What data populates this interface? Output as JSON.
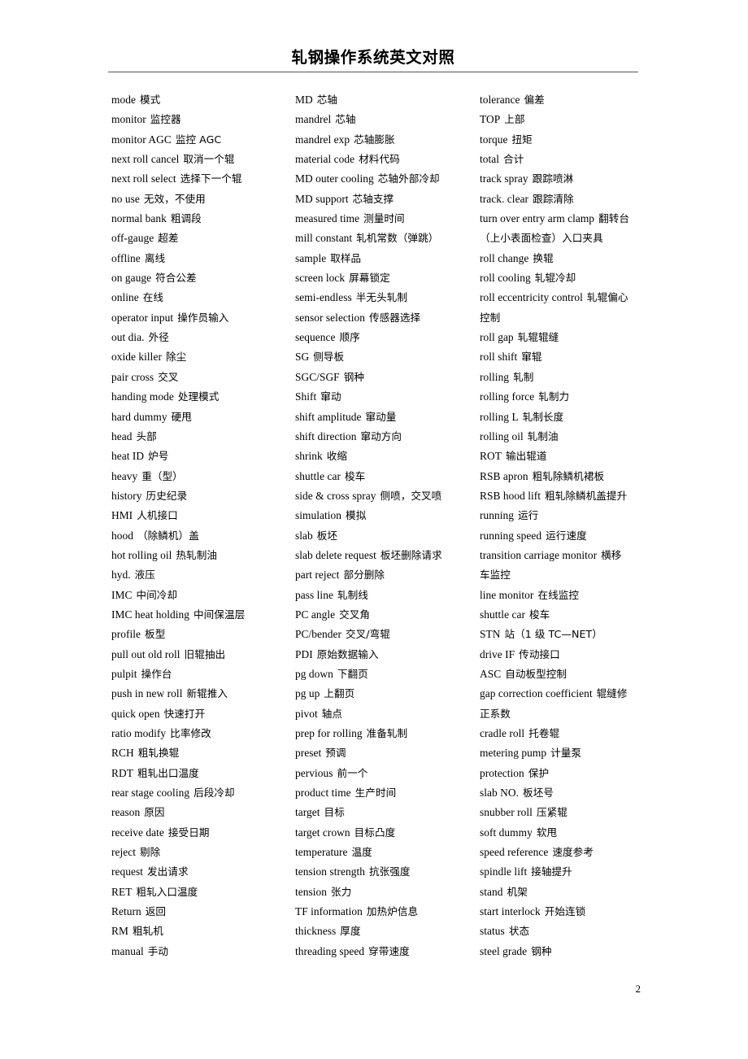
{
  "document": {
    "title": "轧钢操作系统英文对照",
    "page_number": "2",
    "rule_color": "#555555"
  },
  "columns": [
    {
      "id": "column-1",
      "entries": [
        {
          "en": "mode",
          "zh": "模式"
        },
        {
          "en": "monitor",
          "zh": "监控器"
        },
        {
          "en": "monitor AGC",
          "zh": "监控 AGC"
        },
        {
          "en": "next roll cancel",
          "zh": "取消一个辊"
        },
        {
          "en": "next roll select",
          "zh": "选择下一个辊"
        },
        {
          "en": "no use",
          "zh": "无效，不使用"
        },
        {
          "en": "normal bank",
          "zh": "粗调段"
        },
        {
          "en": "off-gauge",
          "zh": "超差"
        },
        {
          "en": "offline",
          "zh": "离线"
        },
        {
          "en": "on gauge",
          "zh": "符合公差"
        },
        {
          "en": "online",
          "zh": "在线"
        },
        {
          "en": "operator input",
          "zh": "操作员输入"
        },
        {
          "en": "out dia.",
          "zh": "外径"
        },
        {
          "en": "oxide killer",
          "zh": "除尘"
        },
        {
          "en": "pair cross",
          "zh": "交叉"
        },
        {
          "en": "handing mode",
          "zh": "处理模式"
        },
        {
          "en": "hard dummy",
          "zh": "硬甩"
        },
        {
          "en": "head",
          "zh": "头部"
        },
        {
          "en": "heat ID",
          "zh": "炉号"
        },
        {
          "en": "heavy",
          "zh": "重（型）"
        },
        {
          "en": "history",
          "zh": "历史纪录"
        },
        {
          "en": "HMI",
          "zh": "人机接口"
        },
        {
          "en": "hood",
          "zh": "（除鳞机）盖"
        },
        {
          "en": "hot rolling oil",
          "zh": "热轧制油"
        },
        {
          "en": "hyd.",
          "zh": "液压"
        },
        {
          "en": "IMC",
          "zh": "中间冷却"
        },
        {
          "en": "IMC heat holding",
          "zh": "中间保温层"
        },
        {
          "en": "profile",
          "zh": "板型"
        },
        {
          "en": "pull out old roll",
          "zh": "旧辊抽出"
        },
        {
          "en": "pulpit",
          "zh": "操作台"
        },
        {
          "en": "push in new roll",
          "zh": "新辊推入"
        },
        {
          "en": "quick open",
          "zh": "快速打开"
        },
        {
          "en": "ratio modify",
          "zh": "比率修改"
        },
        {
          "en": "RCH",
          "zh": "粗轧换辊"
        },
        {
          "en": "RDT",
          "zh": "粗轧出口温度"
        },
        {
          "en": "rear stage cooling",
          "zh": "后段冷却"
        },
        {
          "en": "reason",
          "zh": "原因"
        },
        {
          "en": "receive date",
          "zh": "接受日期"
        },
        {
          "en": "reject",
          "zh": "剔除"
        },
        {
          "en": "request",
          "zh": "发出请求"
        },
        {
          "en": "RET",
          "zh": "粗轧入口温度"
        },
        {
          "en": "Return",
          "zh": "返回"
        },
        {
          "en": "RM",
          "zh": "粗轧机"
        },
        {
          "en": "manual",
          "zh": "手动"
        }
      ]
    },
    {
      "id": "column-2",
      "entries": [
        {
          "en": "MD",
          "zh": "芯轴"
        },
        {
          "en": "mandrel",
          "zh": "芯轴"
        },
        {
          "en": "mandrel exp",
          "zh": "芯轴膨胀"
        },
        {
          "en": "material code",
          "zh": "材料代码"
        },
        {
          "en": "MD outer cooling",
          "zh": "芯轴外部冷却"
        },
        {
          "en": "MD support",
          "zh": "芯轴支撑"
        },
        {
          "en": "measured time",
          "zh": "测量时间"
        },
        {
          "en": "mill constant",
          "zh": "轧机常数（弹跳）"
        },
        {
          "en": "sample",
          "zh": "取样品"
        },
        {
          "en": "screen lock",
          "zh": "屏幕锁定"
        },
        {
          "en": "semi-endless",
          "zh": "半无头轧制"
        },
        {
          "en": "sensor selection",
          "zh": "传感器选择"
        },
        {
          "en": "sequence",
          "zh": "顺序"
        },
        {
          "en": "SG",
          "zh": "侧导板"
        },
        {
          "en": "SGC/SGF",
          "zh": "钢种"
        },
        {
          "en": "Shift",
          "zh": "窜动"
        },
        {
          "en": "shift amplitude",
          "zh": "窜动量"
        },
        {
          "en": "shift direction",
          "zh": "窜动方向"
        },
        {
          "en": "shrink",
          "zh": "收缩"
        },
        {
          "en": "shuttle car",
          "zh": "梭车"
        },
        {
          "en": "side & cross spray",
          "zh": "侧喷，交叉喷"
        },
        {
          "en": "simulation",
          "zh": "模拟"
        },
        {
          "en": "slab",
          "zh": "板坯"
        },
        {
          "en": "slab delete request",
          "zh": "板坯删除请求"
        },
        {
          "en": "part reject",
          "zh": "部分删除"
        },
        {
          "en": "pass line",
          "zh": "轧制线"
        },
        {
          "en": "PC angle",
          "zh": "交叉角"
        },
        {
          "en": "PC/bender",
          "zh": "交叉/弯辊"
        },
        {
          "en": "PDI",
          "zh": "原始数据输入"
        },
        {
          "en": "pg down",
          "zh": "下翻页"
        },
        {
          "en": "pg up",
          "zh": "上翻页"
        },
        {
          "en": "pivot",
          "zh": "轴点"
        },
        {
          "en": "prep for rolling",
          "zh": "准备轧制"
        },
        {
          "en": "preset",
          "zh": "预调"
        },
        {
          "en": "pervious",
          "zh": "前一个"
        },
        {
          "en": "product time",
          "zh": "生产时间"
        },
        {
          "en": "target",
          "zh": "目标"
        },
        {
          "en": "target crown",
          "zh": "目标凸度"
        },
        {
          "en": "temperature",
          "zh": "温度"
        },
        {
          "en": "tension strength",
          "zh": "抗张强度"
        },
        {
          "en": "tension",
          "zh": "张力"
        },
        {
          "en": "TF information",
          "zh": "加热炉信息"
        },
        {
          "en": "thickness",
          "zh": "厚度"
        },
        {
          "en": "threading speed",
          "zh": "穿带速度"
        }
      ]
    },
    {
      "id": "column-3",
      "entries": [
        {
          "en": "tolerance",
          "zh": "偏差"
        },
        {
          "en": "TOP",
          "zh": "上部"
        },
        {
          "en": "torque",
          "zh": "扭矩"
        },
        {
          "en": "total",
          "zh": "合计"
        },
        {
          "en": "track spray",
          "zh": "跟踪喷淋"
        },
        {
          "en": "track. clear",
          "zh": "跟踪清除"
        },
        {
          "en": "turn over entry arm clamp",
          "zh": "翻转台"
        },
        {
          "en": "",
          "zh": "（上小表面检查）入口夹具",
          "continuation": true
        },
        {
          "en": "roll change",
          "zh": "换辊"
        },
        {
          "en": "roll cooling",
          "zh": "轧辊冷却"
        },
        {
          "en": "roll eccentricity control",
          "zh": "轧辊偏心"
        },
        {
          "en": "",
          "zh": "控制",
          "continuation": true
        },
        {
          "en": "roll gap",
          "zh": "轧辊辊缝"
        },
        {
          "en": "roll shift",
          "zh": "窜辊"
        },
        {
          "en": "rolling",
          "zh": "轧制"
        },
        {
          "en": "rolling force",
          "zh": "轧制力"
        },
        {
          "en": "rolling L",
          "zh": "轧制长度"
        },
        {
          "en": "rolling oil",
          "zh": "轧制油"
        },
        {
          "en": "ROT",
          "zh": "输出辊道"
        },
        {
          "en": "RSB apron",
          "zh": "粗轧除鳞机裙板"
        },
        {
          "en": "RSB hood lift",
          "zh": "粗轧除鳞机盖提升"
        },
        {
          "en": "running",
          "zh": "运行"
        },
        {
          "en": "running speed",
          "zh": "运行速度"
        },
        {
          "en": "transition carriage monitor",
          "zh": "横移"
        },
        {
          "en": "",
          "zh": "车监控",
          "continuation": true
        },
        {
          "en": "line monitor",
          "zh": "在线监控"
        },
        {
          "en": "shuttle car",
          "zh": "梭车"
        },
        {
          "en": "STN",
          "zh": "站（1 级 TC—NET）"
        },
        {
          "en": "drive IF",
          "zh": "传动接口"
        },
        {
          "en": "ASC",
          "zh": "自动板型控制"
        },
        {
          "en": "gap correction coefficient",
          "zh": "辊缝修"
        },
        {
          "en": "",
          "zh": "正系数",
          "continuation": true
        },
        {
          "en": "cradle roll",
          "zh": "托卷辊"
        },
        {
          "en": "metering pump",
          "zh": "计量泵"
        },
        {
          "en": "protection",
          "zh": "保护"
        },
        {
          "en": "slab NO.",
          "zh": "板坯号"
        },
        {
          "en": "snubber roll",
          "zh": "压紧辊"
        },
        {
          "en": "soft dummy",
          "zh": "软甩"
        },
        {
          "en": "speed reference",
          "zh": "速度参考"
        },
        {
          "en": "spindle lift",
          "zh": "接轴提升"
        },
        {
          "en": "stand",
          "zh": "机架"
        },
        {
          "en": "start interlock",
          "zh": "开始连锁"
        },
        {
          "en": "status",
          "zh": "状态"
        },
        {
          "en": "steel grade",
          "zh": "钢种"
        }
      ]
    }
  ]
}
